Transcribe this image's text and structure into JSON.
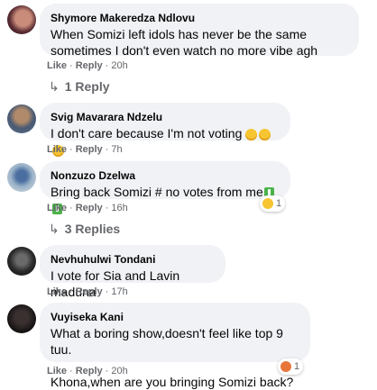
{
  "comments": [
    {
      "author": "Shymore Makeredza Ndlovu",
      "text": "When Somizi left idols has never be the same sometimes I don't even watch no more vibe agh",
      "like": "Like",
      "reply": "Reply",
      "time": "20h",
      "replies_link": "1 Reply"
    },
    {
      "author": "Svig Mavarara Ndzelu",
      "text": "I don't care because I'm not voting",
      "like": "Like",
      "reply": "Reply",
      "time": "7h"
    },
    {
      "author": "Nonzuzo Dzelwa",
      "text": "Bring back Somizi # no votes from me",
      "like": "Like",
      "reply": "Reply",
      "time": "16h",
      "reaction_count": "1",
      "replies_link": "3 Replies"
    },
    {
      "author": "Nevhuhulwi Tondani",
      "text": "I vote for Sia and Lavin maduna",
      "like": "Like",
      "reply": "Reply",
      "time": "17h"
    },
    {
      "author": "Vuyiseka Kani",
      "text": "What a boring show,doesn't feel like top 9 tuu.\n\nKhona,when are you bringing Somizi back?",
      "like": "Like",
      "reply": "Reply",
      "time": "20h",
      "reaction_count": "1"
    }
  ],
  "separator": "·",
  "reply_arrow_icon": "reply-arrow-icon",
  "colors": {
    "bubble": "#f0f2f5",
    "meta": "#65676b",
    "text": "#050505"
  }
}
